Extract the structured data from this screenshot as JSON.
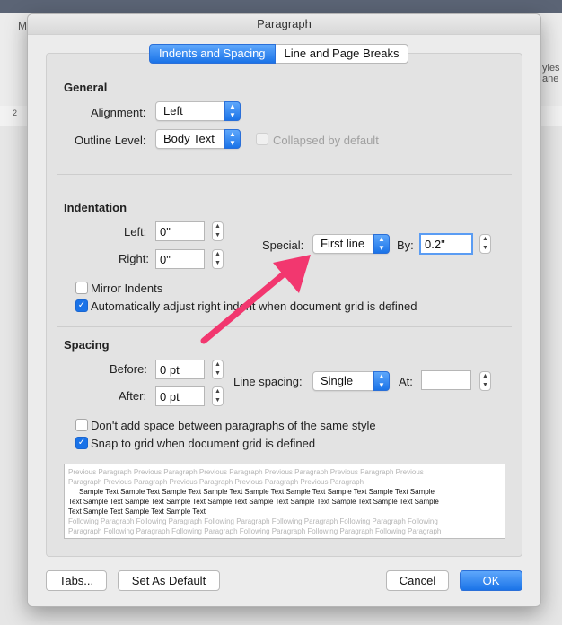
{
  "background": {
    "menu_letter": "M",
    "styles_label_line1": "yles",
    "styles_label_line2": "ane",
    "ruler_number": "2"
  },
  "dialog": {
    "title": "Paragraph",
    "tabs": [
      {
        "label": "Indents and Spacing",
        "active": true
      },
      {
        "label": "Line and Page Breaks",
        "active": false
      }
    ],
    "general": {
      "title": "General",
      "alignment_label": "Alignment:",
      "alignment_value": "Left",
      "outline_label": "Outline Level:",
      "outline_value": "Body Text",
      "collapsed_label": "Collapsed by default"
    },
    "indentation": {
      "title": "Indentation",
      "left_label": "Left:",
      "left_value": "0\"",
      "right_label": "Right:",
      "right_value": "0\"",
      "special_label": "Special:",
      "special_value": "First line",
      "by_label": "By:",
      "by_value": "0.2\"",
      "mirror_label": "Mirror Indents",
      "auto_adjust_label": "Automatically adjust right indent when document grid is defined"
    },
    "spacing": {
      "title": "Spacing",
      "before_label": "Before:",
      "before_value": "0 pt",
      "after_label": "After:",
      "after_value": "0 pt",
      "line_spacing_label": "Line spacing:",
      "line_spacing_value": "Single",
      "at_label": "At:",
      "at_value": "",
      "dont_add_label": "Don't add space between paragraphs of the same style",
      "snap_label": "Snap to grid when document grid is defined"
    },
    "preview": {
      "previous_1": "Previous Paragraph Previous Paragraph Previous Paragraph Previous Paragraph Previous Paragraph Previous",
      "previous_2": "Paragraph Previous Paragraph Previous Paragraph Previous Paragraph Previous Paragraph",
      "sample_1": "Sample Text Sample Text Sample Text Sample Text Sample Text Sample Text Sample Text Sample Text Sample",
      "sample_2": "Text Sample Text Sample Text Sample Text Sample Text Sample Text Sample Text Sample Text Sample Text Sample",
      "sample_3": "Text Sample Text Sample Text Sample Text",
      "following_1": "Following Paragraph Following Paragraph Following Paragraph Following Paragraph Following Paragraph Following",
      "following_2": "Paragraph Following Paragraph Following Paragraph Following Paragraph Following Paragraph Following Paragraph"
    },
    "buttons": {
      "tabs": "Tabs...",
      "set_default": "Set As Default",
      "cancel": "Cancel",
      "ok": "OK"
    }
  },
  "colors": {
    "accent": "#1a73e8",
    "annotation_arrow": "#f2376f"
  }
}
